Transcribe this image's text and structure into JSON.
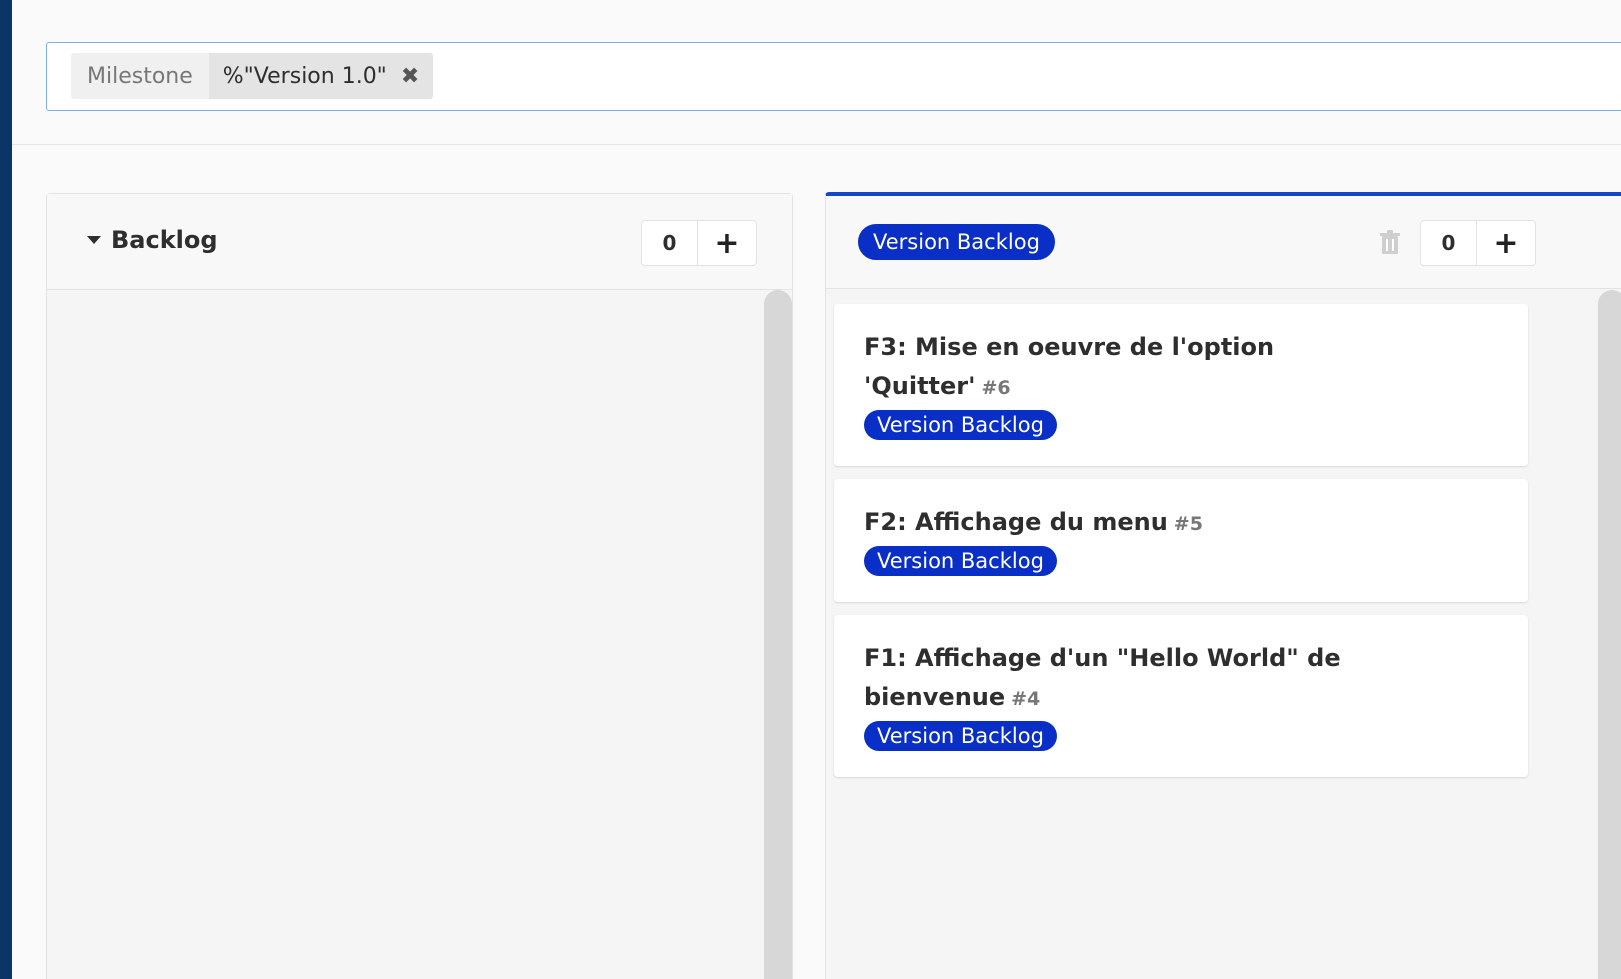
{
  "filter": {
    "token_name": "Milestone",
    "token_value": "%\"Version 1.0\"",
    "close_glyph": "✖"
  },
  "lists": {
    "backlog": {
      "title": "Backlog",
      "count": "0",
      "add_glyph": "+"
    },
    "version": {
      "label": "Version Backlog",
      "count": "0",
      "add_glyph": "+",
      "cards": [
        {
          "title": "F3: Mise en oeuvre de l'option 'Quitter'",
          "ref": "#6",
          "label": "Version Backlog"
        },
        {
          "title": "F2: Affichage du menu",
          "ref": "#5",
          "label": "Version Backlog"
        },
        {
          "title": "F1: Affichage d'un \"Hello World\" de bienvenue",
          "ref": "#4",
          "label": "Version Backlog"
        }
      ]
    }
  },
  "colors": {
    "label_blue": "#0a2fc7",
    "list_top_border": "#1447c8",
    "frame_bg": "#0b3566"
  }
}
